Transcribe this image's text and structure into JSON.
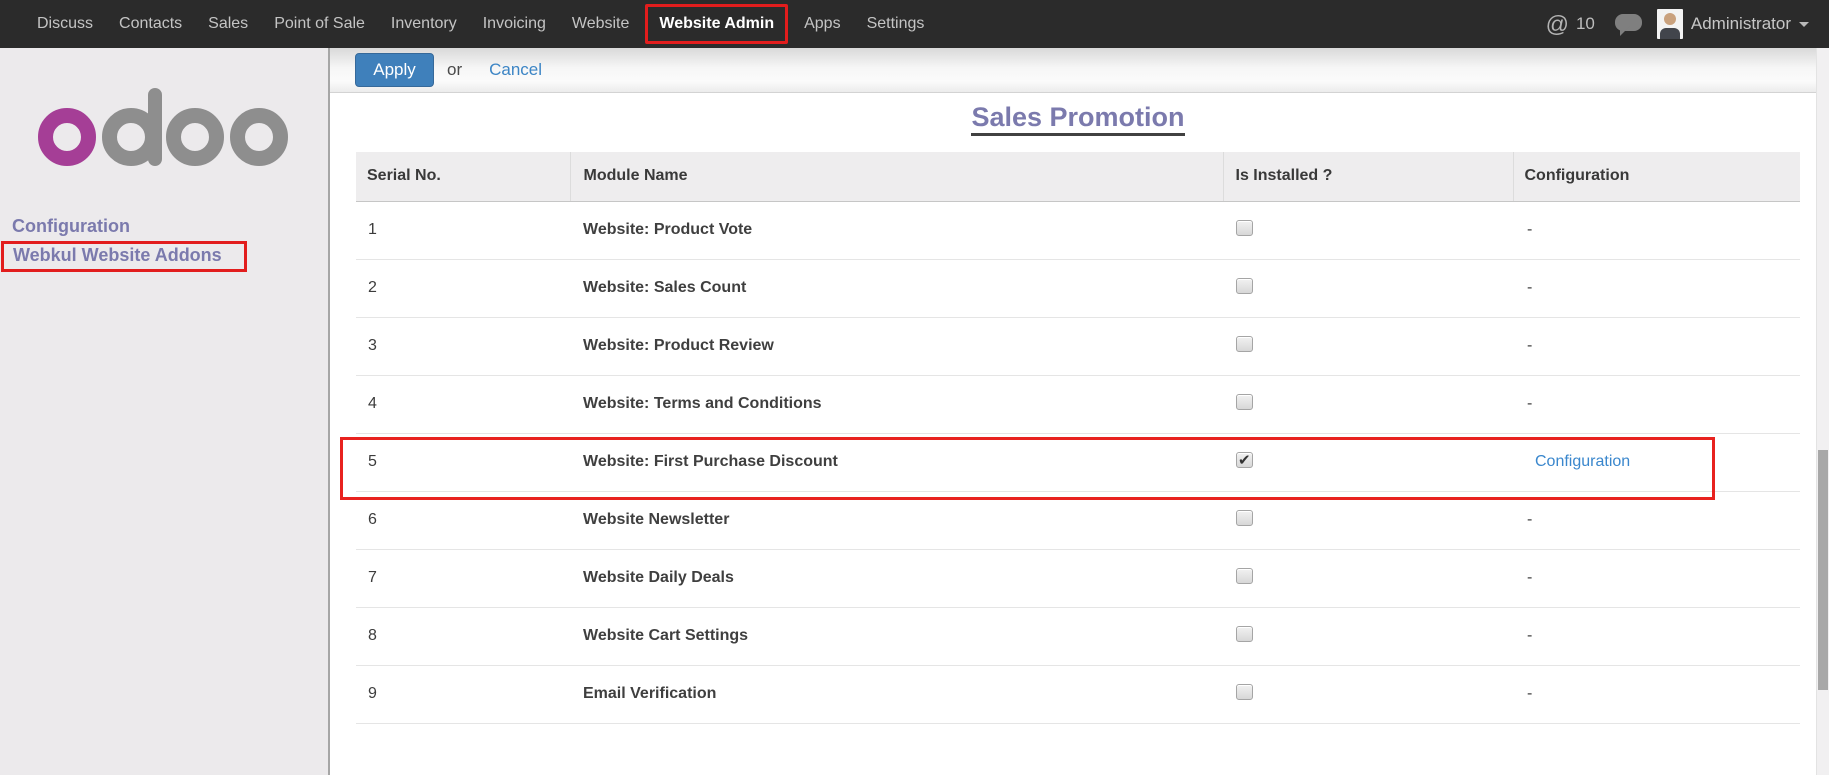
{
  "topbar": {
    "items": [
      {
        "label": "Discuss",
        "active": false
      },
      {
        "label": "Contacts",
        "active": false
      },
      {
        "label": "Sales",
        "active": false
      },
      {
        "label": "Point of Sale",
        "active": false
      },
      {
        "label": "Inventory",
        "active": false
      },
      {
        "label": "Invoicing",
        "active": false
      },
      {
        "label": "Website",
        "active": false
      },
      {
        "label": "Website Admin",
        "active": true
      },
      {
        "label": "Apps",
        "active": false
      },
      {
        "label": "Settings",
        "active": false
      }
    ],
    "mention_count": "10",
    "user_name": "Administrator",
    "icons": [
      "at-icon",
      "chat-bubble-icon",
      "avatar",
      "chevron-down-icon"
    ]
  },
  "sidebar": {
    "logo_text": "odoo",
    "section_title": "Configuration",
    "menu_item": "Webkul Website Addons",
    "menu_item_highlighted": true
  },
  "toolbar": {
    "apply": "Apply",
    "or": "or",
    "cancel": "Cancel"
  },
  "page": {
    "title": "Sales Promotion"
  },
  "table": {
    "headers": [
      "Serial No.",
      "Module Name",
      "Is Installed ?",
      "Configuration"
    ],
    "rows": [
      {
        "serial": "1",
        "module": "Website: Product Vote",
        "installed": false,
        "config": "-",
        "config_link": false,
        "highlighted": false
      },
      {
        "serial": "2",
        "module": "Website: Sales Count",
        "installed": false,
        "config": "-",
        "config_link": false,
        "highlighted": false
      },
      {
        "serial": "3",
        "module": "Website: Product Review",
        "installed": false,
        "config": "-",
        "config_link": false,
        "highlighted": false
      },
      {
        "serial": "4",
        "module": "Website: Terms and Conditions",
        "installed": false,
        "config": "-",
        "config_link": false,
        "highlighted": false
      },
      {
        "serial": "5",
        "module": "Website: First Purchase Discount",
        "installed": true,
        "config": "Configuration",
        "config_link": true,
        "highlighted": true
      },
      {
        "serial": "6",
        "module": "Website Newsletter",
        "installed": false,
        "config": "-",
        "config_link": false,
        "highlighted": false
      },
      {
        "serial": "7",
        "module": "Website Daily Deals",
        "installed": false,
        "config": "-",
        "config_link": false,
        "highlighted": false
      },
      {
        "serial": "8",
        "module": "Website Cart Settings",
        "installed": false,
        "config": "-",
        "config_link": false,
        "highlighted": false
      },
      {
        "serial": "9",
        "module": "Email Verification",
        "installed": false,
        "config": "-",
        "config_link": false,
        "highlighted": false
      }
    ]
  },
  "colors": {
    "navbar_bg": "#2b2b2b",
    "highlight_red": "#e21d1d",
    "accent_purple": "#7b7aad",
    "primary_button_blue": "#3f80bb",
    "link_blue": "#3c85c5",
    "logo_magenta": "#a53e96",
    "logo_gray": "#8e8e8e",
    "sidebar_bg": "#eceaec"
  }
}
